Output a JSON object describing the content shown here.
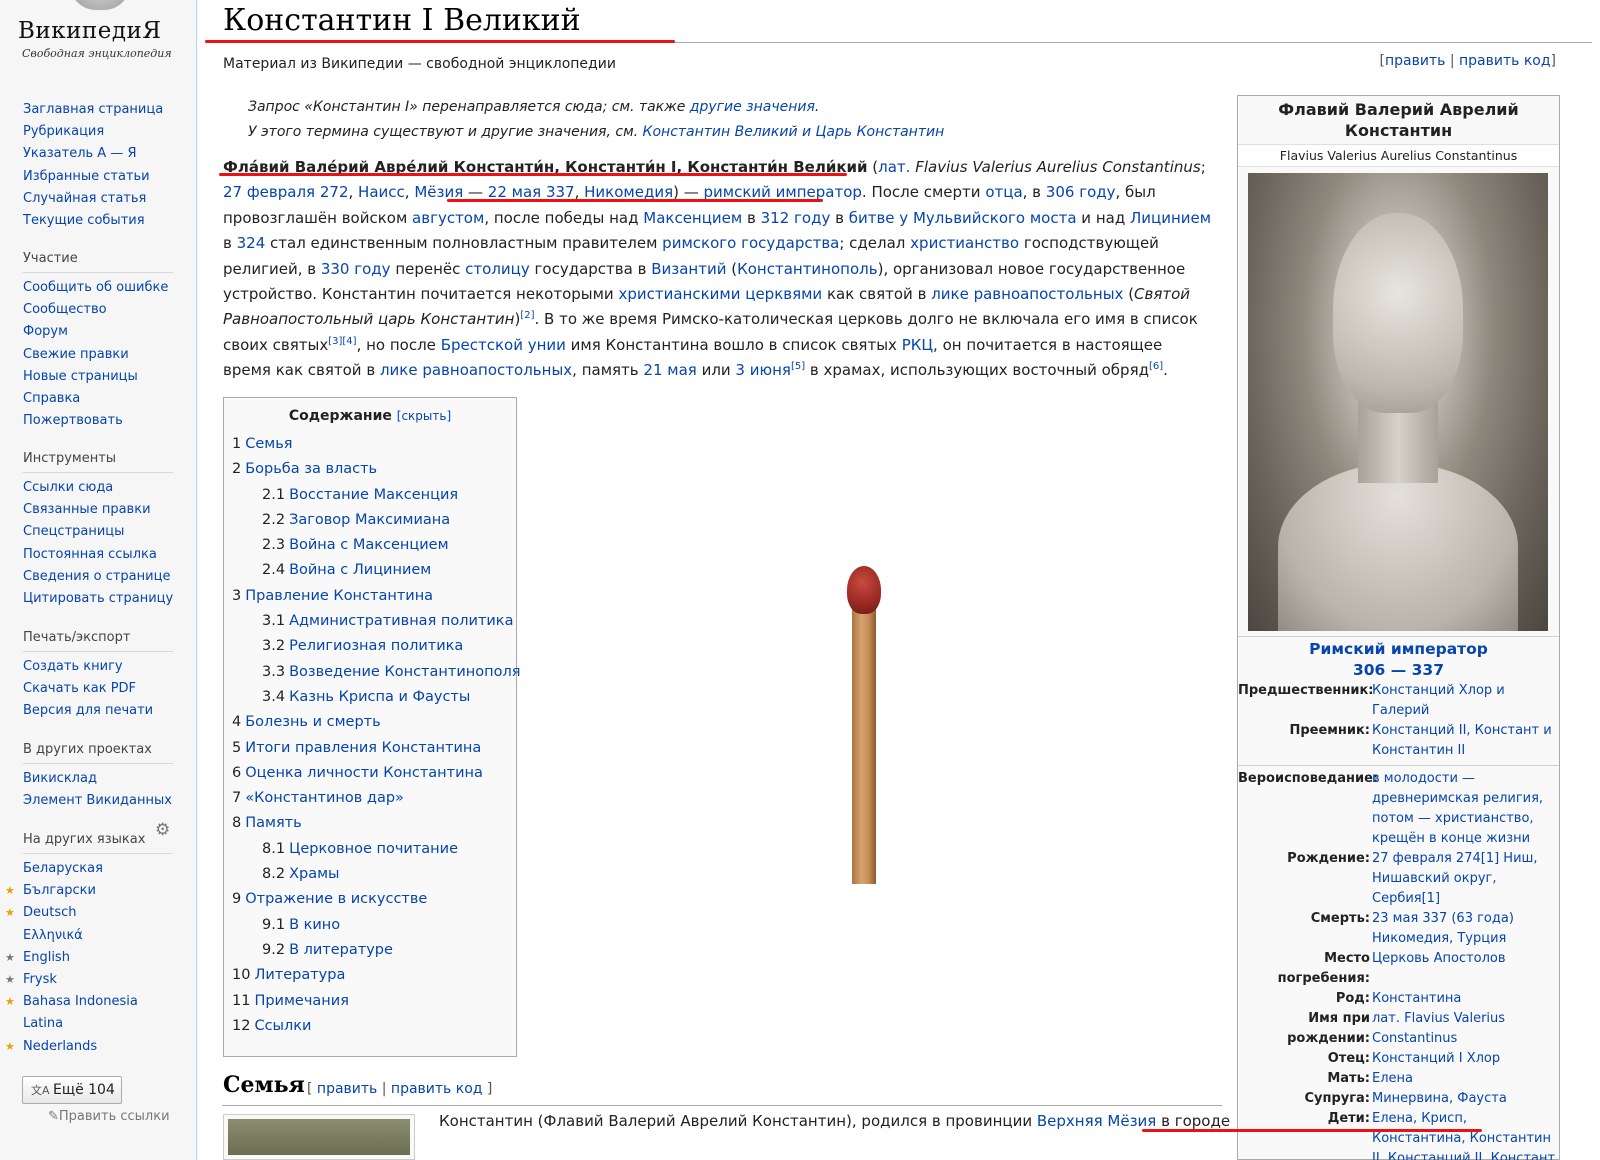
{
  "logo": {
    "title": "ВикипедиЯ",
    "subtitle": "Свободная энциклопедия"
  },
  "sidebar": {
    "main": [
      "Заглавная страница",
      "Рубрикация",
      "Указатель А — Я",
      "Избранные статьи",
      "Случайная статья",
      "Текущие события"
    ],
    "participation": {
      "title": "Участие",
      "items": [
        "Сообщить об ошибке",
        "Сообщество",
        "Форум",
        "Свежие правки",
        "Новые страницы",
        "Справка",
        "Пожертвовать"
      ]
    },
    "tools": {
      "title": "Инструменты",
      "items": [
        "Ссылки сюда",
        "Связанные правки",
        "Спецстраницы",
        "Постоянная ссылка",
        "Сведения о странице",
        "Цитировать страницу"
      ]
    },
    "print": {
      "title": "Печать/экспорт",
      "items": [
        "Создать книгу",
        "Скачать как PDF",
        "Версия для печати"
      ]
    },
    "projects": {
      "title": "В других проектах",
      "items": [
        "Викисклад",
        "Элемент Викиданных"
      ]
    },
    "languages": {
      "title": "На других языках",
      "items": [
        "Беларуская",
        "Български",
        "Deutsch",
        "Ελληνικά",
        "English",
        "Frysk",
        "Bahasa Indonesia",
        "Latina",
        "Nederlands"
      ],
      "more": "Ещё 104",
      "edit_links": "Править ссылки"
    }
  },
  "article": {
    "title": "Константин I Великий",
    "tagline": "Материал из Википедии — свободной энциклопедии",
    "edit": "править",
    "edit_code": "править код",
    "hatnote1_a": "Запрос «Константин I» перенаправляется сюда; см. также ",
    "hatnote1_b": "другие значения",
    "hatnote1_c": ".",
    "hatnote2_a": "У этого термина существуют и другие значения, см. ",
    "hatnote2_b": "Константин Великий и Царь Константин"
  },
  "toc": {
    "title": "Содержание",
    "hide": "[скрыть]",
    "items": [
      {
        "num": "1",
        "label": "Семья",
        "sub": false
      },
      {
        "num": "2",
        "label": "Борьба за власть",
        "sub": false
      },
      {
        "num": "2.1",
        "label": "Восстание Максенция",
        "sub": true
      },
      {
        "num": "2.2",
        "label": "Заговор Максимиана",
        "sub": true
      },
      {
        "num": "2.3",
        "label": "Война с Максенцием",
        "sub": true
      },
      {
        "num": "2.4",
        "label": "Война с Лицинием",
        "sub": true
      },
      {
        "num": "3",
        "label": "Правление Константина",
        "sub": false
      },
      {
        "num": "3.1",
        "label": "Административная политика",
        "sub": true
      },
      {
        "num": "3.2",
        "label": "Религиозная политика",
        "sub": true
      },
      {
        "num": "3.3",
        "label": "Возведение Константинополя",
        "sub": true
      },
      {
        "num": "3.4",
        "label": "Казнь Криспа и Фаусты",
        "sub": true
      },
      {
        "num": "4",
        "label": "Болезнь и смерть",
        "sub": false
      },
      {
        "num": "5",
        "label": "Итоги правления Константина",
        "sub": false
      },
      {
        "num": "6",
        "label": "Оценка личности Константина",
        "sub": false
      },
      {
        "num": "7",
        "label": "«Константинов дар»",
        "sub": false
      },
      {
        "num": "8",
        "label": "Память",
        "sub": false
      },
      {
        "num": "8.1",
        "label": "Церковное почитание",
        "sub": true
      },
      {
        "num": "8.2",
        "label": "Храмы",
        "sub": true
      },
      {
        "num": "9",
        "label": "Отражение в искусстве",
        "sub": false
      },
      {
        "num": "9.1",
        "label": "В кино",
        "sub": true
      },
      {
        "num": "9.2",
        "label": "В литературе",
        "sub": true
      },
      {
        "num": "10",
        "label": "Литература",
        "sub": false
      },
      {
        "num": "11",
        "label": "Примечания",
        "sub": false
      },
      {
        "num": "12",
        "label": "Ссылки",
        "sub": false
      }
    ]
  },
  "section": {
    "title": "Семья",
    "first_para_a": "Константин (Флавий Валерий Аврелий Константин), родился в провинции ",
    "first_para_link": "Верхняя Мёзия",
    "first_para_b": " в городе"
  },
  "infobox": {
    "title": "Флавий Валерий Аврелий Константин",
    "latin": "Flavius Valerius Aurelius Constantinus",
    "role": "Римский император",
    "reign": "306 — 337",
    "rows": [
      {
        "label": "Предшественник:",
        "value": "Констанций Хлор и Галерий"
      },
      {
        "label": "Преемник:",
        "value": "Констанций II, Констант и Константин II"
      },
      {
        "label": "Вероисповедание:",
        "value": "в молодости — древнеримская религия, потом — христианство, крещён в конце жизни"
      },
      {
        "label": "Рождение:",
        "value": "27 февраля 274[1] Ниш, Нишавский округ, Сербия[1]"
      },
      {
        "label": "Смерть:",
        "value": "23 мая 337 (63 года) Никомедия, Турция"
      },
      {
        "label": "Место погребения:",
        "value": "Церковь Апостолов"
      },
      {
        "label": "Род:",
        "value": "Константина"
      },
      {
        "label": "Имя при рождении:",
        "value": "лат. Flavius Valerius Constantinus"
      },
      {
        "label": "Отец:",
        "value": "Констанций I Хлор"
      },
      {
        "label": "Мать:",
        "value": "Елена"
      },
      {
        "label": "Супруга:",
        "value": "Минервина, Фауста"
      },
      {
        "label": "Дети:",
        "value": "Елена, Крисп, Константина, Константин II, Констанций II, Констант"
      }
    ]
  }
}
